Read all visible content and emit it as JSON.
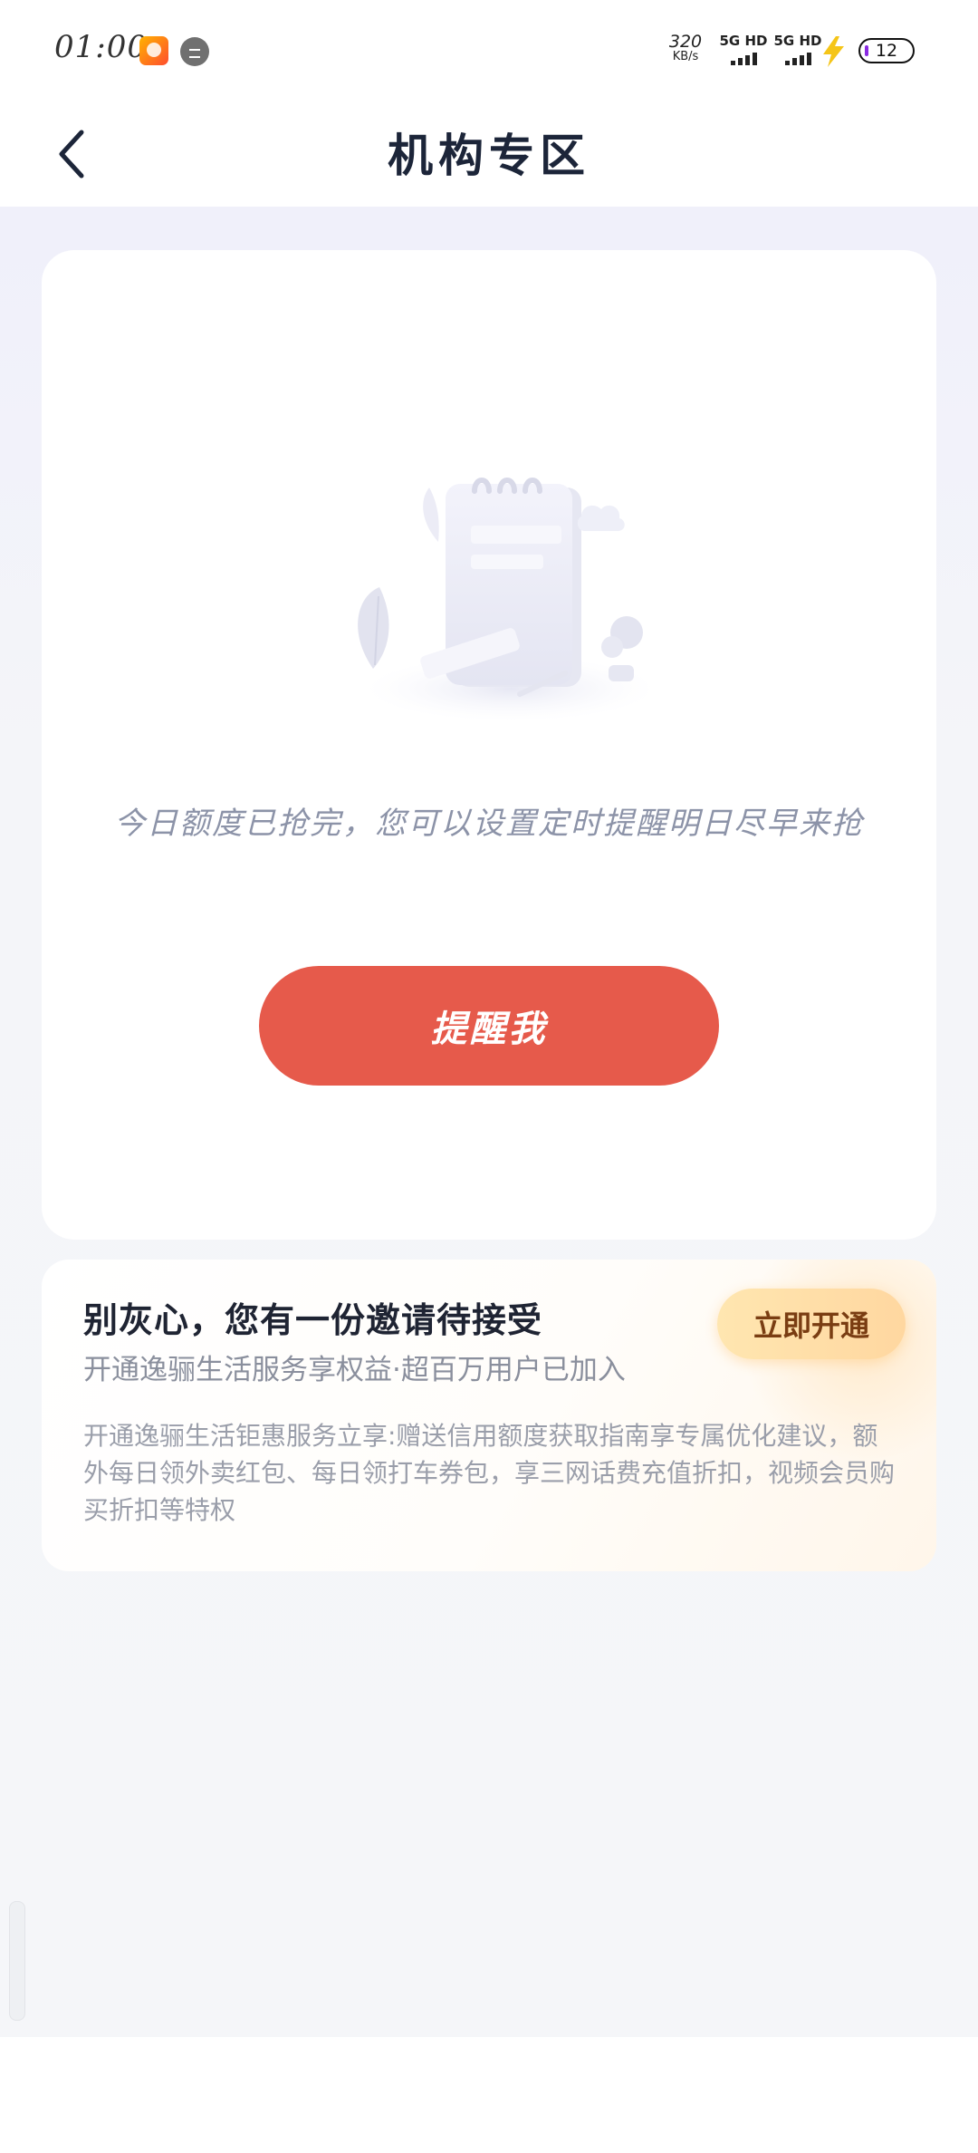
{
  "status_bar": {
    "time": "01:00",
    "net_speed_value": "320",
    "net_speed_unit": "KB/s",
    "sim1_label": "5G HD",
    "sim2_label": "5G HD",
    "battery": "12"
  },
  "header": {
    "title": "机构专区"
  },
  "empty_state": {
    "message": "今日额度已抢完，您可以设置定时提醒明日尽早来抢",
    "button_label": "提醒我"
  },
  "invite": {
    "title": "别灰心，您有一份邀请待接受",
    "subtitle": "开通逸骊生活服务享权益·超百万用户已加入",
    "button_label": "立即开通",
    "description": "开通逸骊生活钜惠服务立享:赠送信用额度获取指南享专属优化建议，额外每日领外卖红包、每日领打车券包，享三网话费充值折扣，视频会员购买折扣等特权"
  },
  "colors": {
    "accent_red": "#e65a4b",
    "gold_button": "#ffd7a0",
    "title_dark": "#1c2539"
  }
}
